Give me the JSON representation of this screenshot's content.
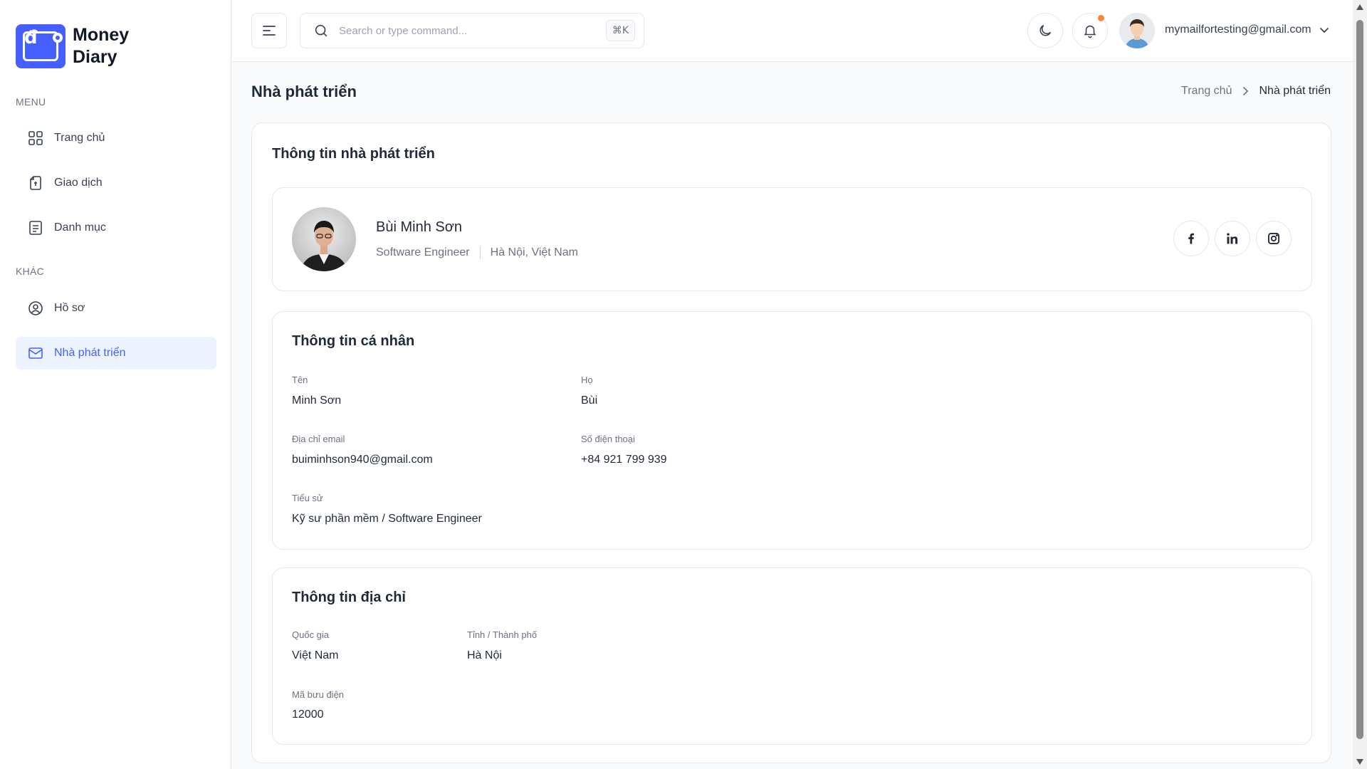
{
  "app": {
    "name": "Money Diary",
    "name_line1": "Money",
    "name_line2": "Diary",
    "logo_glyph": "đ"
  },
  "sidebar": {
    "menu_heading": "MENU",
    "other_heading": "KHÁC",
    "menu_items": [
      {
        "label": "Trang chủ",
        "icon": "grid-icon"
      },
      {
        "label": "Giao dịch",
        "icon": "document-icon"
      },
      {
        "label": "Danh mục",
        "icon": "list-icon"
      }
    ],
    "other_items": [
      {
        "label": "Hồ sơ",
        "icon": "user-circle-icon"
      },
      {
        "label": "Nhà phát triển",
        "icon": "mail-icon",
        "active": true
      }
    ]
  },
  "header": {
    "search_placeholder": "Search or type command...",
    "search_shortcut": "⌘K",
    "user_email": "mymailfortesting@gmail.com",
    "has_notification": true
  },
  "page": {
    "title": "Nhà phát triển",
    "breadcrumb": {
      "home": "Trang chủ",
      "current": "Nhà phát triển"
    }
  },
  "developer": {
    "card_title": "Thông tin nhà phát triển",
    "name": "Bùi Minh Sơn",
    "role": "Software Engineer",
    "location": "Hà Nội, Việt Nam",
    "socials": [
      "facebook-icon",
      "linkedin-icon",
      "instagram-icon"
    ]
  },
  "personal": {
    "title": "Thông tin cá nhân",
    "first_name_label": "Tên",
    "first_name": "Minh Sơn",
    "last_name_label": "Họ",
    "last_name": "Bùi",
    "email_label": "Địa chỉ email",
    "email": "buiminhson940@gmail.com",
    "phone_label": "Số điện thoại",
    "phone": "+84 921 799 939",
    "bio_label": "Tiểu sử",
    "bio": "Kỹ sư phần mềm / Software Engineer"
  },
  "address": {
    "title": "Thông tin địa chỉ",
    "country_label": "Quốc gia",
    "country": "Việt Nam",
    "city_label": "Tỉnh / Thành phố",
    "city": "Hà Nội",
    "postal_label": "Mã bưu điện",
    "postal": "12000"
  },
  "colors": {
    "brand": "#465fff",
    "active_bg": "#ecf3ff",
    "notification": "#fd853a"
  }
}
